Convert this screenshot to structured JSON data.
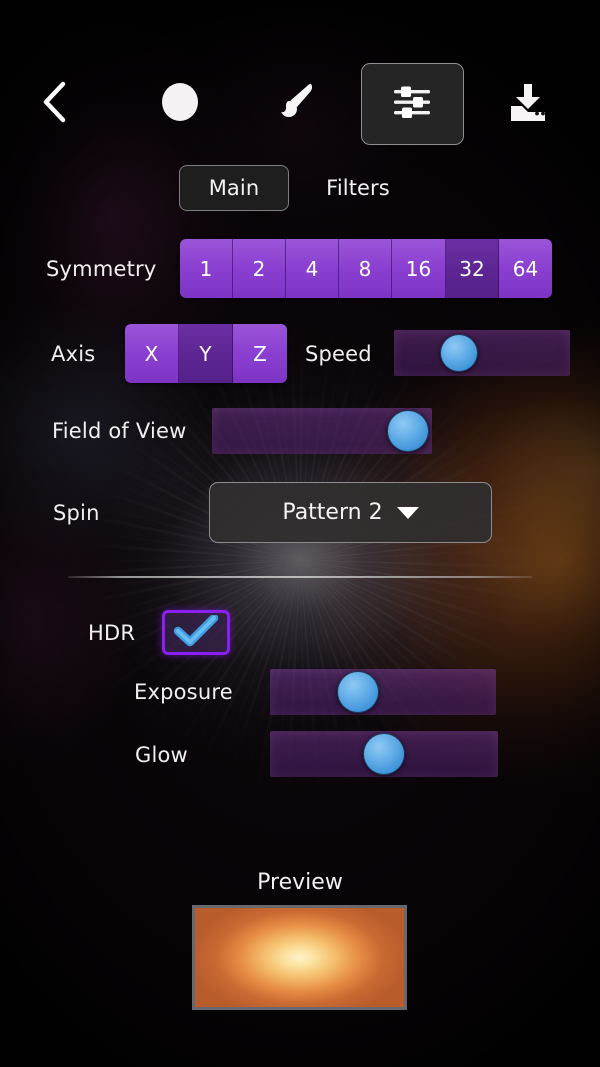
{
  "toolbar": {
    "back_icon": "chevron-left-icon",
    "shape_icon": "circle-icon",
    "brush_icon": "paintbrush-icon",
    "tune_icon": "sliders-settings-icon",
    "save_icon": "download-save-icon"
  },
  "tabs": [
    {
      "label": "Main",
      "active": true
    },
    {
      "label": "Filters",
      "active": false
    }
  ],
  "controls": {
    "symmetry": {
      "label": "Symmetry",
      "options": [
        "1",
        "2",
        "4",
        "8",
        "16",
        "32",
        "64"
      ],
      "selected": "32"
    },
    "axis": {
      "label": "Axis",
      "options": [
        "X",
        "Y",
        "Z"
      ],
      "selected": "Y"
    },
    "speed": {
      "label": "Speed",
      "value_pct": 37
    },
    "field_of_view": {
      "label": "Field of View",
      "value_pct": 89
    },
    "spin": {
      "label": "Spin",
      "selected": "Pattern 2",
      "caret_icon": "chevron-down-icon"
    }
  },
  "hdr_section": {
    "hdr": {
      "label": "HDR",
      "checked": true,
      "check_icon": "checkmark-icon"
    },
    "exposure": {
      "label": "Exposure",
      "value_pct": 39
    },
    "glow": {
      "label": "Glow",
      "value_pct": 50
    }
  },
  "preview": {
    "label": "Preview"
  },
  "colors": {
    "segment": "#8a3fd0",
    "segment_selected": "#5d2593",
    "slider_thumb": "#63aee8",
    "checkbox_border": "#8b1ff0",
    "preview_center": "#fdf3c9",
    "preview_edge": "#b85c2c"
  }
}
